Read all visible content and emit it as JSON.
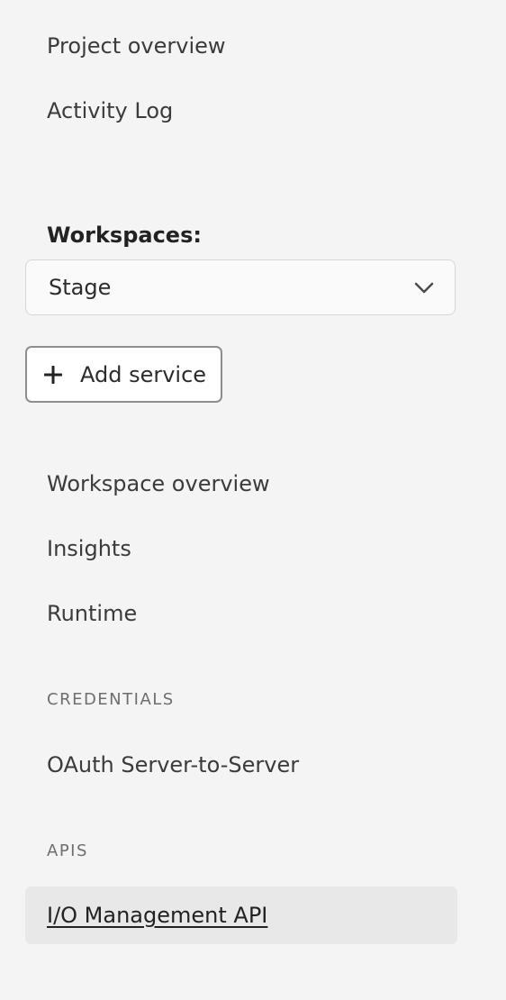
{
  "nav": {
    "project_overview": "Project overview",
    "activity_log": "Activity Log",
    "workspace_overview": "Workspace overview",
    "insights": "Insights",
    "runtime": "Runtime"
  },
  "workspaces": {
    "label": "Workspaces:",
    "selected": "Stage",
    "chevron_icon": "chevron-down-icon"
  },
  "add_service": {
    "label": "Add service",
    "icon": "plus-icon"
  },
  "credentials": {
    "heading": "CREDENTIALS",
    "items": [
      "OAuth Server-to-Server"
    ]
  },
  "apis": {
    "heading": "APIS",
    "items": [
      "I/O Management API"
    ]
  },
  "colors": {
    "background": "#f4f4f4",
    "selected_background": "#e8e8e8",
    "text": "#2c2c2c",
    "muted": "#6e6e6e"
  }
}
